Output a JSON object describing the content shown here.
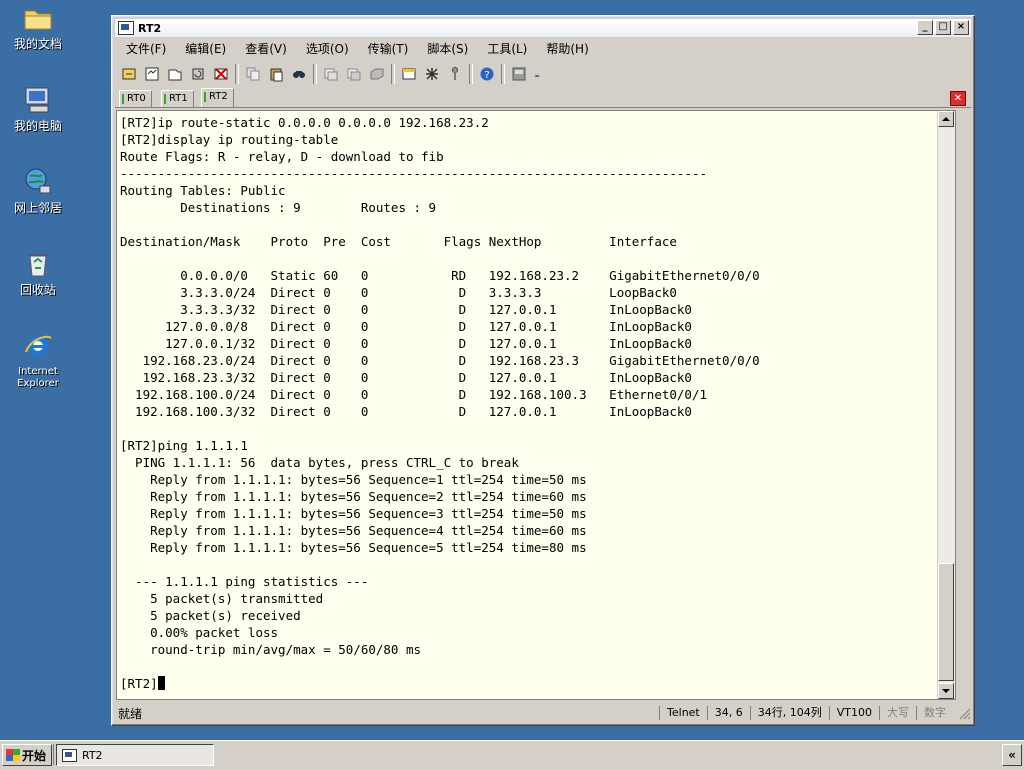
{
  "desktop": {
    "icons": [
      {
        "label": "我的文档"
      },
      {
        "label": "我的电脑"
      },
      {
        "label": "网上邻居"
      },
      {
        "label": "回收站"
      },
      {
        "label_line1": "Internet",
        "label_line2": "Explorer"
      }
    ]
  },
  "window": {
    "title": "RT2",
    "buttons": {
      "minimize": "_",
      "maximize": "□",
      "close": "×"
    }
  },
  "menu": [
    "文件(F)",
    "编辑(E)",
    "查看(V)",
    "选项(O)",
    "传输(T)",
    "脚本(S)",
    "工具(L)",
    "帮助(H)"
  ],
  "toolbar_icons": [
    "connect-icon",
    "quick-connect-icon",
    "connect-tab-icon",
    "reconnect-icon",
    "disconnect-icon",
    "copy-icon",
    "paste-icon",
    "find-icon",
    "print-icon",
    "print-screen-icon",
    "print-setup-icon",
    "session-options-icon",
    "global-options-icon",
    "key-icon",
    "help-icon",
    "script-icon",
    "more-icon"
  ],
  "tabs": [
    {
      "label": "RT0",
      "active": false
    },
    {
      "label": "RT1",
      "active": false
    },
    {
      "label": "RT2",
      "active": true
    }
  ],
  "terminal": {
    "lines": [
      "[RT2]ip route-static 0.0.0.0 0.0.0.0 192.168.23.2",
      "[RT2]display ip routing-table",
      "Route Flags: R - relay, D - download to fib",
      "------------------------------------------------------------------------------",
      "Routing Tables: Public",
      "        Destinations : 9        Routes : 9",
      "",
      "Destination/Mask    Proto  Pre  Cost       Flags NextHop         Interface",
      "",
      "        0.0.0.0/0   Static 60   0           RD   192.168.23.2    GigabitEthernet0/0/0",
      "        3.3.3.0/24  Direct 0    0            D   3.3.3.3         LoopBack0",
      "        3.3.3.3/32  Direct 0    0            D   127.0.0.1       InLoopBack0",
      "      127.0.0.0/8   Direct 0    0            D   127.0.0.1       InLoopBack0",
      "      127.0.0.1/32  Direct 0    0            D   127.0.0.1       InLoopBack0",
      "   192.168.23.0/24  Direct 0    0            D   192.168.23.3    GigabitEthernet0/0/0",
      "   192.168.23.3/32  Direct 0    0            D   127.0.0.1       InLoopBack0",
      "  192.168.100.0/24  Direct 0    0            D   192.168.100.3   Ethernet0/0/1",
      "  192.168.100.3/32  Direct 0    0            D   127.0.0.1       InLoopBack0",
      "",
      "[RT2]ping 1.1.1.1",
      "  PING 1.1.1.1: 56  data bytes, press CTRL_C to break",
      "    Reply from 1.1.1.1: bytes=56 Sequence=1 ttl=254 time=50 ms",
      "    Reply from 1.1.1.1: bytes=56 Sequence=2 ttl=254 time=60 ms",
      "    Reply from 1.1.1.1: bytes=56 Sequence=3 ttl=254 time=50 ms",
      "    Reply from 1.1.1.1: bytes=56 Sequence=4 ttl=254 time=60 ms",
      "    Reply from 1.1.1.1: bytes=56 Sequence=5 ttl=254 time=80 ms",
      "",
      "  --- 1.1.1.1 ping statistics ---",
      "    5 packet(s) transmitted",
      "    5 packet(s) received",
      "    0.00% packet loss",
      "    round-trip min/avg/max = 50/60/80 ms",
      ""
    ],
    "prompt": "[RT2]"
  },
  "status": {
    "main": "就绪",
    "protocol": "Telnet",
    "position": "34,    6",
    "size": "34行, 104列",
    "terminal_type": "VT100",
    "caps": "大写",
    "num": "数字"
  },
  "taskbar": {
    "start_label": "开始",
    "task_label": "RT2",
    "tray_button": "«"
  }
}
